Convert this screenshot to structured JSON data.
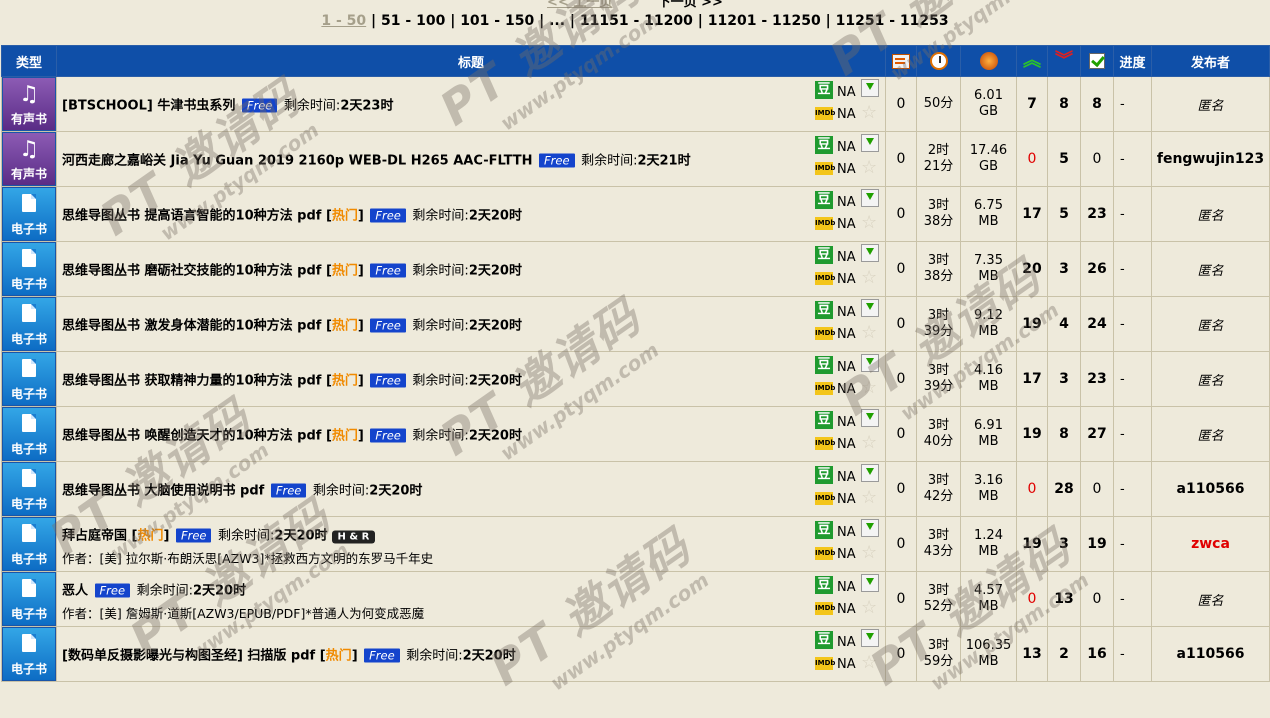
{
  "pager": {
    "prev": "<< 上一页",
    "next": "下一页 >>",
    "pages": [
      "1 - 50",
      "51 - 100",
      "101 - 150",
      "...",
      "11151 - 11200",
      "11201 - 11250",
      "11251 - 11253"
    ]
  },
  "header": {
    "type": "类型",
    "title": "标题",
    "progress": "进度",
    "publisher": "发布者"
  },
  "labels": {
    "douban": "豆",
    "imdb": "IMDb",
    "na": "NA",
    "free": "Free",
    "hot": "热门",
    "remain": "剩余时间:",
    "hr": "H & R",
    "dash": "-"
  },
  "rows": [
    {
      "cat": "有声书",
      "cat_type": "audio",
      "title": "[BTSCHOOL] 牛津书虫系列",
      "hot": false,
      "remain": "2天23时",
      "sub": "",
      "hr": false,
      "comments": "0",
      "time1": "50分",
      "time2": "",
      "size1": "6.01",
      "size2": "GB",
      "seeders": "7",
      "seed_zero": false,
      "leechers": "8",
      "done": "8",
      "done_bold": true,
      "progress": "-",
      "publisher": "匿名",
      "pub_style": "anon"
    },
    {
      "cat": "有声书",
      "cat_type": "audio",
      "title": "河西走廊之嘉峪关 Jia Yu Guan 2019 2160p WEB-DL H265 AAC-FLTTH",
      "hot": false,
      "remain": "2天21时",
      "sub": "",
      "hr": false,
      "comments": "0",
      "time1": "2时",
      "time2": "21分",
      "size1": "17.46",
      "size2": "GB",
      "seeders": "0",
      "seed_zero": true,
      "leechers": "5",
      "done": "0",
      "done_bold": false,
      "progress": "-",
      "publisher": "fengwujin123",
      "pub_style": "bold"
    },
    {
      "cat": "电子书",
      "cat_type": "ebook",
      "title": "思维导图丛书 提高语言智能的10种方法 pdf",
      "hot": true,
      "remain": "2天20时",
      "sub": "",
      "hr": false,
      "comments": "0",
      "time1": "3时",
      "time2": "38分",
      "size1": "6.75",
      "size2": "MB",
      "seeders": "17",
      "seed_zero": false,
      "leechers": "5",
      "done": "23",
      "done_bold": true,
      "progress": "-",
      "publisher": "匿名",
      "pub_style": "anon"
    },
    {
      "cat": "电子书",
      "cat_type": "ebook",
      "title": "思维导图丛书 磨砺社交技能的10种方法 pdf",
      "hot": true,
      "remain": "2天20时",
      "sub": "",
      "hr": false,
      "comments": "0",
      "time1": "3时",
      "time2": "38分",
      "size1": "7.35",
      "size2": "MB",
      "seeders": "20",
      "seed_zero": false,
      "leechers": "3",
      "done": "26",
      "done_bold": true,
      "progress": "-",
      "publisher": "匿名",
      "pub_style": "anon"
    },
    {
      "cat": "电子书",
      "cat_type": "ebook",
      "title": "思维导图丛书 激发身体潜能的10种方法 pdf",
      "hot": true,
      "remain": "2天20时",
      "sub": "",
      "hr": false,
      "comments": "0",
      "time1": "3时",
      "time2": "39分",
      "size1": "9.12",
      "size2": "MB",
      "seeders": "19",
      "seed_zero": false,
      "leechers": "4",
      "done": "24",
      "done_bold": true,
      "progress": "-",
      "publisher": "匿名",
      "pub_style": "anon"
    },
    {
      "cat": "电子书",
      "cat_type": "ebook",
      "title": "思维导图丛书 获取精神力量的10种方法 pdf",
      "hot": true,
      "remain": "2天20时",
      "sub": "",
      "hr": false,
      "comments": "0",
      "time1": "3时",
      "time2": "39分",
      "size1": "4.16",
      "size2": "MB",
      "seeders": "17",
      "seed_zero": false,
      "leechers": "3",
      "done": "23",
      "done_bold": true,
      "progress": "-",
      "publisher": "匿名",
      "pub_style": "anon"
    },
    {
      "cat": "电子书",
      "cat_type": "ebook",
      "title": "思维导图丛书 唤醒创造天才的10种方法 pdf",
      "hot": true,
      "remain": "2天20时",
      "sub": "",
      "hr": false,
      "comments": "0",
      "time1": "3时",
      "time2": "40分",
      "size1": "6.91",
      "size2": "MB",
      "seeders": "19",
      "seed_zero": false,
      "leechers": "8",
      "done": "27",
      "done_bold": true,
      "progress": "-",
      "publisher": "匿名",
      "pub_style": "anon"
    },
    {
      "cat": "电子书",
      "cat_type": "ebook",
      "title": "思维导图丛书 大脑使用说明书 pdf",
      "hot": false,
      "remain": "2天20时",
      "sub": "",
      "hr": false,
      "comments": "0",
      "time1": "3时",
      "time2": "42分",
      "size1": "3.16",
      "size2": "MB",
      "seeders": "0",
      "seed_zero": true,
      "leechers": "28",
      "done": "0",
      "done_bold": false,
      "progress": "-",
      "publisher": "a110566",
      "pub_style": "bold"
    },
    {
      "cat": "电子书",
      "cat_type": "ebook",
      "title": "拜占庭帝国",
      "hot": true,
      "remain": "2天20时",
      "sub": "作者：[美] 拉尔斯·布朗沃思[AZW3]*拯救西方文明的东罗马千年史",
      "hr": true,
      "comments": "0",
      "time1": "3时",
      "time2": "43分",
      "size1": "1.24",
      "size2": "MB",
      "seeders": "19",
      "seed_zero": false,
      "leechers": "3",
      "done": "19",
      "done_bold": true,
      "progress": "-",
      "publisher": "zwca",
      "pub_style": "red"
    },
    {
      "cat": "电子书",
      "cat_type": "ebook",
      "title": "恶人",
      "hot": false,
      "remain": "2天20时",
      "sub": "作者：[美] 詹姆斯·道斯[AZW3/EPUB/PDF]*普通人为何变成恶魔",
      "hr": false,
      "comments": "0",
      "time1": "3时",
      "time2": "52分",
      "size1": "4.57",
      "size2": "MB",
      "seeders": "0",
      "seed_zero": true,
      "leechers": "13",
      "done": "0",
      "done_bold": false,
      "progress": "-",
      "publisher": "匿名",
      "pub_style": "anon"
    },
    {
      "cat": "电子书",
      "cat_type": "ebook",
      "title": "[数码单反摄影曝光与构图圣经] 扫描版 pdf",
      "hot": true,
      "remain": "2天20时",
      "sub": "",
      "hr": false,
      "comments": "0",
      "time1": "3时",
      "time2": "59分",
      "size1": "106.35",
      "size2": "MB",
      "seeders": "13",
      "seed_zero": false,
      "leechers": "2",
      "done": "16",
      "done_bold": true,
      "progress": "-",
      "publisher": "a110566",
      "pub_style": "bold"
    }
  ],
  "watermark": {
    "brand": "PT 邀请码",
    "url": "www.ptyqm.com"
  }
}
